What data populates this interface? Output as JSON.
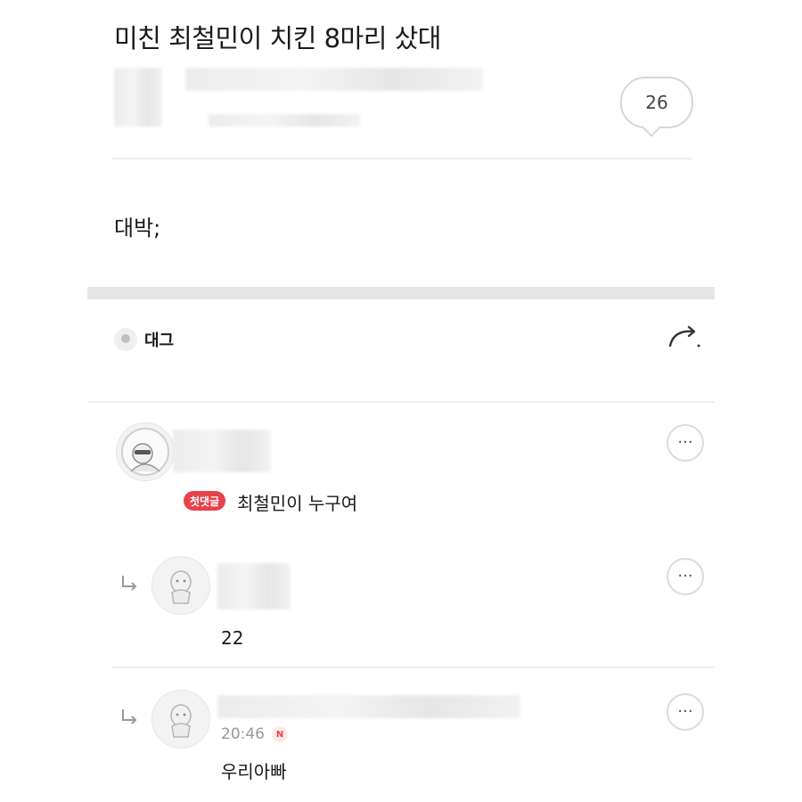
{
  "post": {
    "title": "미친 최철민이 치킨 8마리 샀대",
    "comment_count": "26",
    "body": "대박;"
  },
  "toolbar": {
    "label": "대그"
  },
  "comments": [
    {
      "badge": "첫댓글",
      "text": "최철민이 누구여",
      "more": "···"
    },
    {
      "text": "22",
      "more": "···"
    },
    {
      "time": "20:46",
      "new_badge": "N",
      "text": "우리아빠",
      "more": "···"
    }
  ],
  "icons": {
    "share": "share-arrow-icon",
    "reply": "reply-arrow-icon",
    "more": "more-dots-icon",
    "avatar": "user-avatar-icon"
  },
  "colors": {
    "badge": "#e8414a",
    "divider": "#e5e5e6",
    "meta_text": "#9a9a9a"
  }
}
